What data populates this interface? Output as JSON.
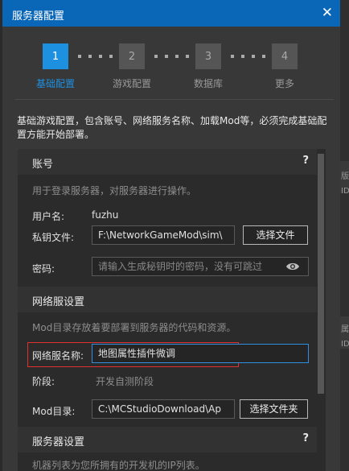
{
  "background_snippets": [
    "版本",
    "ID",
    "属纹",
    "ID"
  ],
  "dialog": {
    "title": "服务器配置",
    "close_symbol": "✕"
  },
  "steps": [
    {
      "number": "1",
      "label": "基础配置",
      "active": true
    },
    {
      "number": "2",
      "label": "游戏配置",
      "active": false
    },
    {
      "number": "3",
      "label": "数据库",
      "active": false
    },
    {
      "number": "4",
      "label": "更多",
      "active": false
    }
  ],
  "intro_text": "基础游戏配置，包含账号、网络服务名称、加载Mod等，必须完成基础配置方能开始部署。",
  "account": {
    "header": "账号",
    "help": "?",
    "description": "用于登录服务器，对服务器进行操作。",
    "username_label": "用户名:",
    "username_value": "fuzhu",
    "key_label": "私钥文件:",
    "key_value": "F:\\NetworkGameMod\\sim\\",
    "key_button": "选择文件",
    "password_label": "密码:",
    "password_placeholder": "请输入生成秘钥时的密码，没有可跳过",
    "password_icon": "eye-icon"
  },
  "network": {
    "header": "网络服设置",
    "description": "Mod目录存放着要部署到服务器的代码和资源。",
    "name_label": "网络服名称:",
    "name_value": "地图属性插件微调",
    "stage_label": "阶段:",
    "stage_value": "开发自测阶段",
    "mod_label": "Mod目录:",
    "mod_value": "C:\\MCStudioDownload\\Ap",
    "mod_button": "选择文件夹"
  },
  "server": {
    "header": "服务器设置",
    "help": "?",
    "description": "机器列表为您所拥有的开发机的IP列表。"
  },
  "colors": {
    "titlebar": "#0a66b6",
    "accent": "#1e90e0",
    "highlight": "#e03030"
  }
}
